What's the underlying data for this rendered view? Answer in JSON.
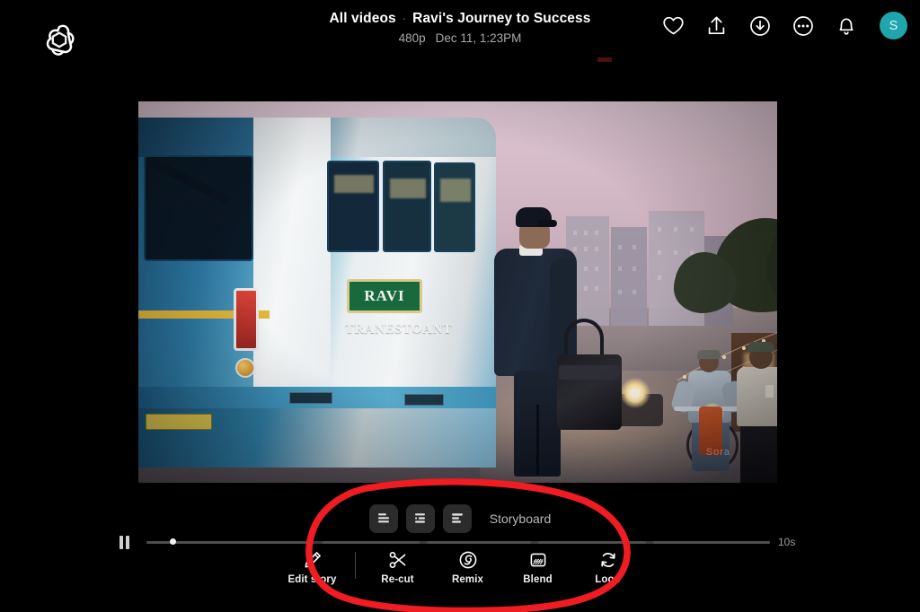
{
  "app": {
    "brand": "openai-logo",
    "background_color": "#000000"
  },
  "header": {
    "breadcrumb_root": "All videos",
    "breadcrumb_separator": "·",
    "title": "Ravi's Journey to Success",
    "resolution": "480p",
    "timestamp": "Dec 11, 1:23PM",
    "actions": [
      {
        "name": "favorite-icon",
        "label": "Favorite"
      },
      {
        "name": "share-icon",
        "label": "Share"
      },
      {
        "name": "download-icon",
        "label": "Download"
      },
      {
        "name": "more-options-icon",
        "label": "More options"
      },
      {
        "name": "notifications-icon",
        "label": "Notifications"
      }
    ],
    "avatar": {
      "initial": "S",
      "color": "#1fa6ac"
    }
  },
  "video": {
    "scene_description": "Night street scene: blue and white city bus departing at left, a man in a dark suit with a cap carrying a bag walking away, a cyclist with a lit headlamp and a pedestrian on a market street with string lights and shop signs",
    "bus_plate_text": "RAVI",
    "bus_subtext": "TRANESTOANT",
    "watermark": "Sora"
  },
  "storyboard": {
    "label": "Storyboard",
    "view_buttons": [
      {
        "name": "storyboard-view-compact",
        "label": "Compact view"
      },
      {
        "name": "storyboard-view-list",
        "label": "List view"
      },
      {
        "name": "storyboard-view-detailed",
        "label": "Detailed view"
      }
    ]
  },
  "playback": {
    "state_icon": "pause-icon",
    "current_position": "0s",
    "duration": "10s",
    "progress_percent": 4
  },
  "toolbar": {
    "items": [
      {
        "label": "Edit story",
        "icon": "pencil-icon",
        "name": "edit-story-button"
      },
      {
        "label": "Re-cut",
        "icon": "scissors-icon",
        "name": "re-cut-button"
      },
      {
        "label": "Remix",
        "icon": "remix-spiral-icon",
        "name": "remix-button"
      },
      {
        "label": "Blend",
        "icon": "blend-icon",
        "name": "blend-button"
      },
      {
        "label": "Loop",
        "icon": "loop-icon",
        "name": "loop-button"
      }
    ]
  },
  "annotation": {
    "type": "hand-drawn-ellipse",
    "color": "#ef1c22",
    "description": "Red hand-drawn circle highlighting the storyboard row and the editing toolbar"
  }
}
